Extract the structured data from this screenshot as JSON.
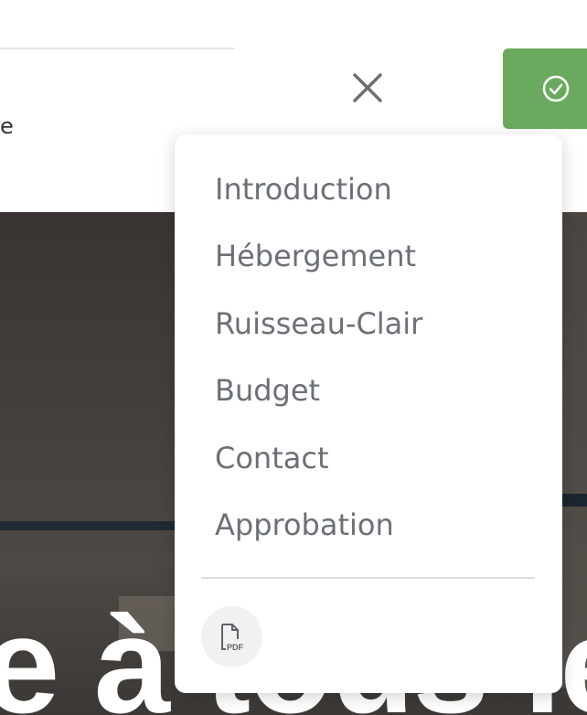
{
  "header": {
    "left_fragment_text": "e",
    "close_icon": "close-icon",
    "approve_icon": "check-circle-icon"
  },
  "colors": {
    "approve_bg": "#6aaa5e",
    "icon_gray": "#6b7076",
    "pdf_bg": "#f1f1f1"
  },
  "hero": {
    "text": "e à tous les"
  },
  "menu": {
    "items": [
      {
        "label": "Introduction"
      },
      {
        "label": "Hébergement"
      },
      {
        "label": "Ruisseau-Clair"
      },
      {
        "label": "Budget"
      },
      {
        "label": "Contact"
      },
      {
        "label": "Approbation"
      }
    ],
    "pdf_icon": "pdf-file-icon",
    "pdf_label": "PDF"
  }
}
